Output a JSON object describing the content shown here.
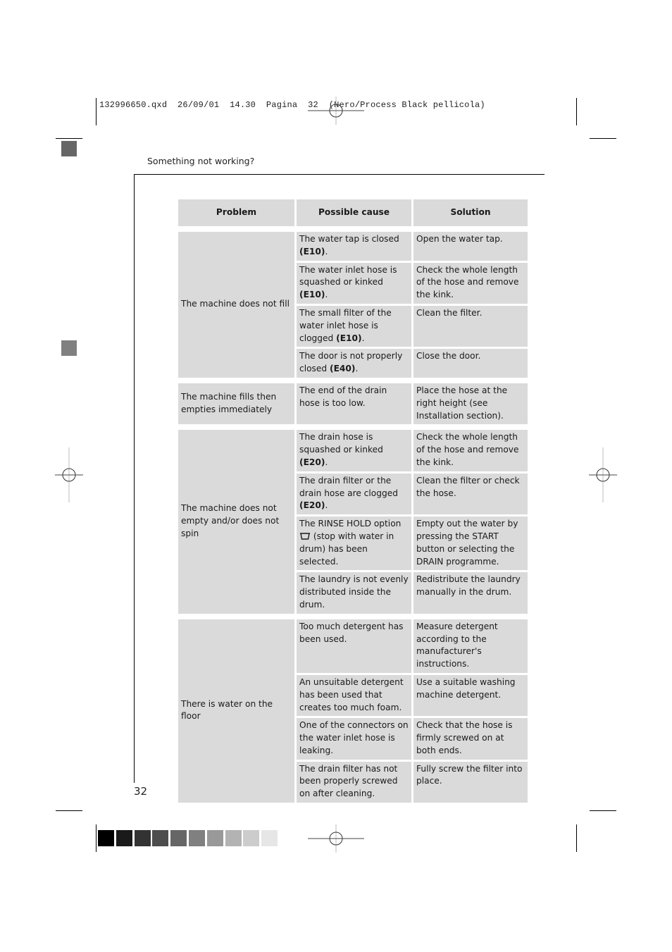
{
  "slug": {
    "filename": "132996650.qxd",
    "date": "26/09/01",
    "time": "14.30",
    "page_label": "Pagina",
    "page_number": "32",
    "separation": "(Nero/Process Black pellicola)"
  },
  "header": {
    "title": "Something not working?"
  },
  "table": {
    "headers": [
      "Problem",
      "Possible cause",
      "Solution"
    ],
    "groups": [
      {
        "problem": "The machine does not fill",
        "rows": [
          {
            "cause": "The water tap is closed ",
            "cause_code": "(E10)",
            "cause_tail": ".",
            "solution": "Open the water tap."
          },
          {
            "cause": "The water inlet hose is squashed or kinked ",
            "cause_code": "(E10)",
            "cause_tail": ".",
            "solution": "Check the whole length of the hose and remove the kink."
          },
          {
            "cause": "The small filter of the water inlet hose is clogged ",
            "cause_code": "(E10)",
            "cause_tail": ".",
            "solution": "Clean the filter."
          },
          {
            "cause": "The door is not properly closed ",
            "cause_code": "(E40)",
            "cause_tail": ".",
            "solution": "Close the door."
          }
        ]
      },
      {
        "problem": "The machine fills then empties immediately",
        "rows": [
          {
            "cause": "The end of the drain hose is too low.",
            "cause_code": "",
            "cause_tail": "",
            "solution": "Place the hose at the right height (see Installation section)."
          }
        ]
      },
      {
        "problem": "The machine does not empty and/or does not spin",
        "rows": [
          {
            "cause": "The drain hose is squashed or kinked ",
            "cause_code": "(E20)",
            "cause_tail": ".",
            "solution": "Check the whole length of the hose and remove the kink."
          },
          {
            "cause": "The drain filter or the drain hose are clogged ",
            "cause_code": "(E20)",
            "cause_tail": ".",
            "solution": "Clean the filter or check the hose."
          },
          {
            "cause": "The RINSE HOLD option ",
            "cause_icon": "rinse-hold-icon",
            "cause_after_icon": " (stop with water in drum) has been selected.",
            "solution": "Empty out the water by pressing the START button or selecting the DRAIN programme."
          },
          {
            "cause": "The laundry is not evenly distributed inside the drum.",
            "cause_code": "",
            "cause_tail": "",
            "solution": "Redistribute the laundry manually in the drum."
          }
        ]
      },
      {
        "problem": "There is water on the floor",
        "rows": [
          {
            "cause": "Too much detergent has been used.",
            "cause_code": "",
            "cause_tail": "",
            "solution": "Measure detergent according to the manufacturer's instructions."
          },
          {
            "cause": "An unsuitable detergent has been used that creates too much foam.",
            "cause_code": "",
            "cause_tail": "",
            "solution": "Use a suitable washing machine detergent."
          },
          {
            "cause": "One of the connectors on the water inlet hose is leaking.",
            "cause_code": "",
            "cause_tail": "",
            "solution": "Check that the hose is firmly screwed on at both ends."
          },
          {
            "cause": "The drain filter has not been properly screwed on after cleaning.",
            "cause_code": "",
            "cause_tail": "",
            "solution": "Fully screw the filter into place."
          }
        ]
      }
    ]
  },
  "footer": {
    "page_number": "32"
  },
  "colors": {
    "cell_bg": "#dadada",
    "tab_marker": "#666666",
    "grayscale_bar": [
      "#000000",
      "#1a1a1a",
      "#333333",
      "#4d4d4d",
      "#666666",
      "#808080",
      "#999999",
      "#b3b3b3",
      "#cccccc",
      "#e6e6e6"
    ]
  }
}
